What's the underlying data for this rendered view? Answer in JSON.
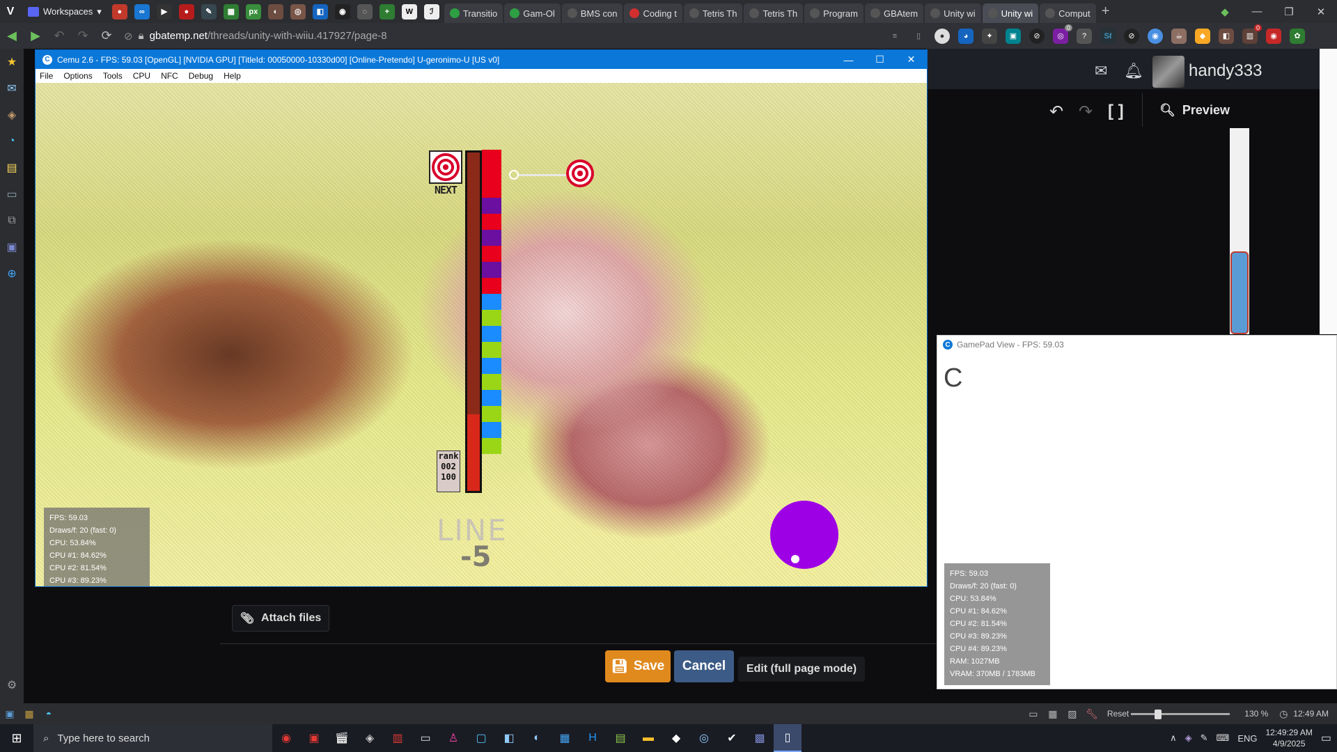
{
  "browser": {
    "workspaces_label": "Workspaces",
    "url_host": "gbatemp.net",
    "url_path": "/threads/unity-with-wiiu.417927/page-8",
    "tabs": [
      {
        "label": "Transitio",
        "color": "#2ea043"
      },
      {
        "label": "Gam-Ol",
        "color": "#2ea043"
      },
      {
        "label": "BMS con",
        "color": "#555"
      },
      {
        "label": "Coding t",
        "color": "#d32f2f"
      },
      {
        "label": "Tetris Th",
        "color": "#555"
      },
      {
        "label": "Tetris Th",
        "color": "#555"
      },
      {
        "label": "Program",
        "color": "#555"
      },
      {
        "label": "GBAtem",
        "color": "#555"
      },
      {
        "label": "Unity wi",
        "color": "#555"
      },
      {
        "label": "Unity wi",
        "color": "#555",
        "active": true
      },
      {
        "label": "Comput",
        "color": "#555"
      }
    ],
    "status": {
      "reset_label": "Reset",
      "zoom": "130 %",
      "time": "12:49 AM"
    },
    "badges": {
      "ext1": "0",
      "ext2": "0"
    }
  },
  "site": {
    "username": "handy333",
    "preview_label": "Preview",
    "attach_label": "Attach files",
    "save_label": "Save",
    "cancel_label": "Cancel",
    "fullpage_label": "Edit (full page mode)"
  },
  "cemu": {
    "title": "Cemu 2.6 - FPS: 59.03 [OpenGL] [NVIDIA GPU] [TitleId: 00050000-10330d00] [Online-Pretendo] U-geronimo-U [US v0]",
    "menu": [
      "File",
      "Options",
      "Tools",
      "CPU",
      "NFC",
      "Debug",
      "Help"
    ],
    "game": {
      "next_label": "NEXT",
      "rank_lines": [
        "rank",
        "002",
        "100"
      ],
      "line_label": "LINE",
      "line_count": "-5",
      "column_colors": [
        "#e8001c",
        "#e8001c",
        "#e8001c",
        "#6b0fa0",
        "#e8001c",
        "#6b0fa0",
        "#e8001c",
        "#6b0fa0",
        "#e8001c",
        "#1a8cff",
        "#9ad616",
        "#1a8cff",
        "#9ad616",
        "#1a8cff",
        "#9ad616",
        "#1a8cff",
        "#9ad616",
        "#1a8cff",
        "#9ad616"
      ]
    },
    "stats": [
      "FPS: 59.03",
      "Draws/f: 20 (fast: 0)",
      "CPU: 53.84%",
      "CPU #1: 84.62%",
      "CPU #2: 81.54%",
      "CPU #3: 89.23%",
      "CPU #4: 89.23%",
      "RAM: 1027MB",
      "VRAM: 370MB / 1783MB"
    ]
  },
  "gamepad": {
    "title": "GamePad View - FPS: 59.03",
    "loading_glyph": "C"
  },
  "taskbar": {
    "search_placeholder": "Type here to search",
    "lang": "ENG",
    "clock_time": "12:49:29 AM",
    "clock_date": "4/9/2025"
  }
}
